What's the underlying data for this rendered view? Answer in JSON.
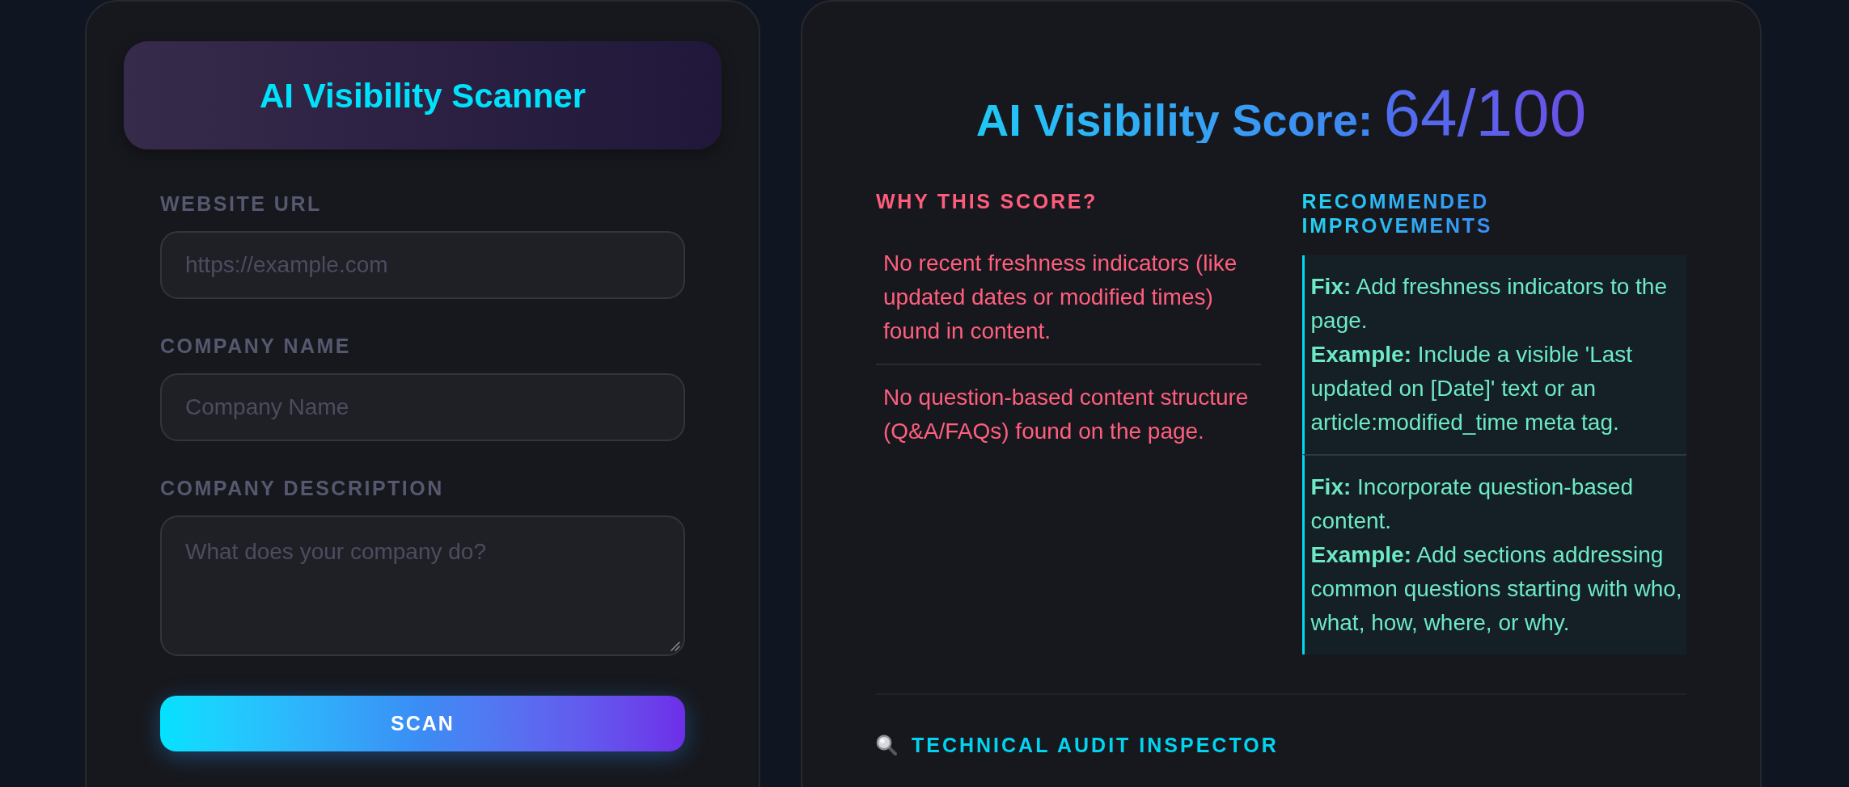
{
  "scanner": {
    "title": "AI Visibility Scanner",
    "fields": [
      {
        "kind": "input",
        "label": "WEBSITE URL",
        "placeholder": "https://example.com"
      },
      {
        "kind": "input",
        "label": "COMPANY NAME",
        "placeholder": "Company Name"
      },
      {
        "kind": "textarea",
        "label": "COMPANY DESCRIPTION",
        "placeholder": "What does your company do?"
      }
    ],
    "button": "SCAN"
  },
  "results": {
    "title": "AI Visibility Score:",
    "score": "64/100",
    "reasons_heading": "WHY THIS SCORE?",
    "reasons": [
      "No recent freshness indicators (like updated dates or modified times) found in content.",
      "No question-based content structure (Q&A/FAQs) found on the page."
    ],
    "improvements_heading": "RECOMMENDED IMPROVEMENTS",
    "improvements": [
      {
        "lines": [
          "**Fix:** Add freshness indicators to the page.",
          "**Example:** Include a visible 'Last updated on [Date]' text or an article:modified_time meta tag."
        ]
      },
      {
        "lines": [
          "**Fix:** Incorporate question-based content.",
          "**Example:** Add sections addressing common questions starting with who, what, how, where, or why."
        ]
      }
    ],
    "audit_heading": "TECHNICAL AUDIT INSPECTOR"
  }
}
